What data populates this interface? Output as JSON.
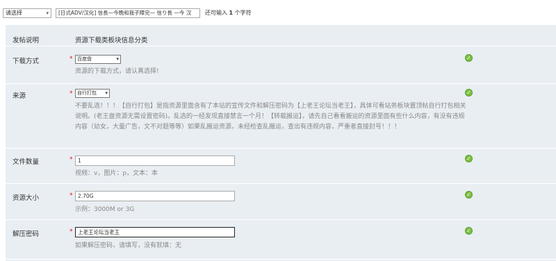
{
  "topbar": {
    "type_select_value": "请选择",
    "title_value": "[日式ADV/汉化] 信長—今晩和我子障完— 信り長 —今 汉",
    "remaining_prefix": "还可输入",
    "remaining_count": "1",
    "remaining_suffix": "个字符"
  },
  "form": {
    "header": {
      "label": "发帖说明",
      "text": "资源下载类板块信息分类"
    },
    "download": {
      "label": "下载方式",
      "required_mark": "*",
      "value": "百度盘",
      "hint": "资源的下载方式，请认真选择!"
    },
    "source": {
      "label": "来源",
      "required_mark": "*",
      "value": "自行打包",
      "hint": "不要乱选！！！【自行打包】是指资源里面含有了本站的宣传文件和解压密码为【上老王论坛当老王】，具体可看站务板块置顶帖自行打包相关说明。(老王盘资源无需设置密码)。乱选的一经发现直接禁言一个月！【转载搬运】，请先自己看看搬运的资源里面有些什么内容，有没有违规内容（幼女，大量广告，文不对题等等）如果乱搬运资源，未经检查乱搬运，查出有违规内容，严重者直接封号！！！"
    },
    "file_count": {
      "label": "文件数量",
      "required_mark": "*",
      "value": "1",
      "hint": "视频：v，图片：p，文本：本"
    },
    "size": {
      "label": "资源大小",
      "required_mark": "*",
      "value": "2.70G",
      "hint": "示例：3000M or 3G"
    },
    "password": {
      "label": "解压密码",
      "required_mark": "*",
      "value": "上老王论坛当老王",
      "hint": "如果解压密码，请填写，没有就填：无"
    }
  },
  "icons": {
    "valid": "check-circle-icon",
    "dropdown": "chevron-down-icon"
  },
  "colors": {
    "form_bg": "#e9eef3",
    "required": "#e01010",
    "valid": "#7cc142",
    "hint": "#888888"
  }
}
